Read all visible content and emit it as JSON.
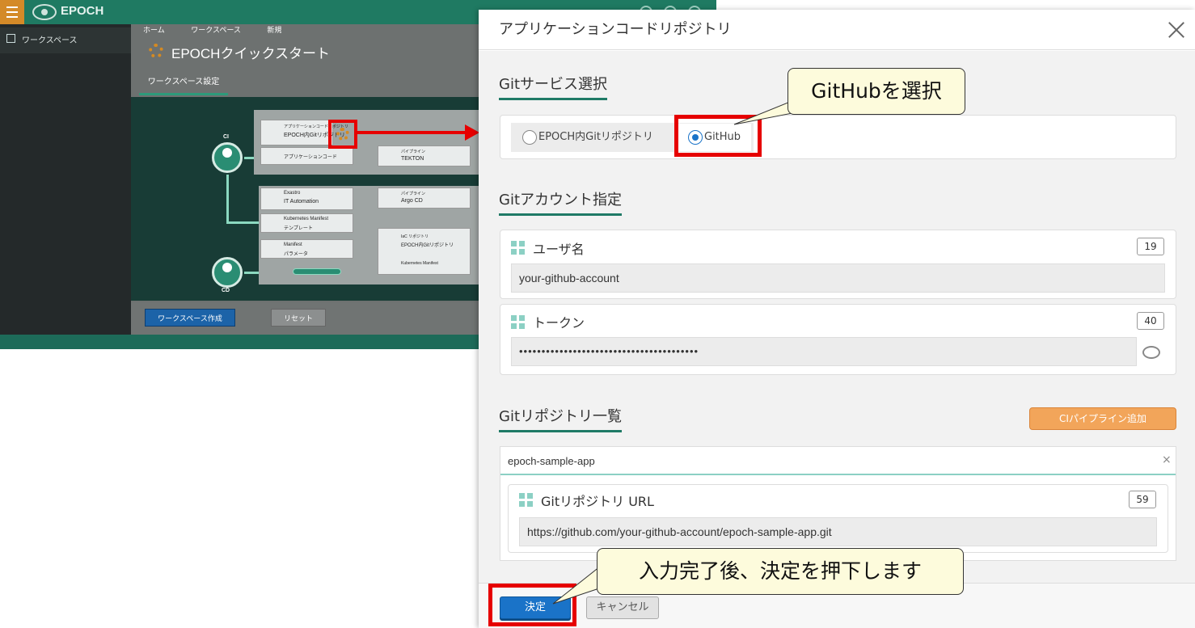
{
  "background_app": {
    "logo": "EPOCH",
    "sidebar_item": "ワークスペース",
    "breadcrumb": [
      "ホーム",
      "ワークスペース",
      "新規"
    ],
    "page_title": "EPOCHクイックスタート",
    "tab": "ワークスペース設定",
    "diagram": {
      "app_code_repo_title": "アプリケーションコードリポジトリ",
      "app_code_repo_name": "EPOCH内Gitリポジトリ",
      "app_code_row": "アプリケーションコード",
      "pipeline_label": "パイプライン",
      "pipeline_tekton": "TEKTON",
      "exastro": "Exastro",
      "it_automation": "IT Automation",
      "k8s_manifest": "Kubernetes Manifest",
      "template": "テンプレート",
      "manifest": "Manifest",
      "parameter": "パラメータ",
      "argo_cd": "Argo CD",
      "iac_repo": "IaC リポジトリ",
      "iac_repo_name": "EPOCH内Gitリポジトリ",
      "k8s_manifest2": "Kubernetes Manifest",
      "ci_label": "CI",
      "cd_label": "CD"
    },
    "create_button": "ワークスペース作成",
    "reset_button": "リセット"
  },
  "modal": {
    "title": "アプリケーションコードリポジトリ",
    "git_service": {
      "heading": "Gitサービス選択",
      "options": [
        "EPOCH内Gitリポジトリ",
        "GitHub"
      ],
      "selected": "GitHub"
    },
    "git_account": {
      "heading": "Gitアカウント指定",
      "username_label": "ユーザ名",
      "username_count": "19",
      "username_value": "your-github-account",
      "token_label": "トークン",
      "token_count": "40",
      "token_value": "••••••••••••••••••••••••••••••••••••••••"
    },
    "repo_list": {
      "heading": "Gitリポジトリ一覧",
      "add_ci_button": "CIパイプライン追加",
      "repo_name": "epoch-sample-app",
      "remove": "×",
      "url_label": "Gitリポジトリ URL",
      "url_count": "59",
      "url_value": "https://github.com/your-github-account/epoch-sample-app.git"
    },
    "ok_button": "決定",
    "cancel_button": "キャンセル"
  },
  "annotations": {
    "callout_github": "GitHubを選択",
    "callout_submit": "入力完了後、決定を押下します"
  },
  "colors": {
    "accent_teal": "#1f7a66",
    "primary_blue": "#1a73c8",
    "orange": "#f2a55a",
    "highlight_red": "#e60000",
    "callout_bg": "#fdfbdc"
  }
}
